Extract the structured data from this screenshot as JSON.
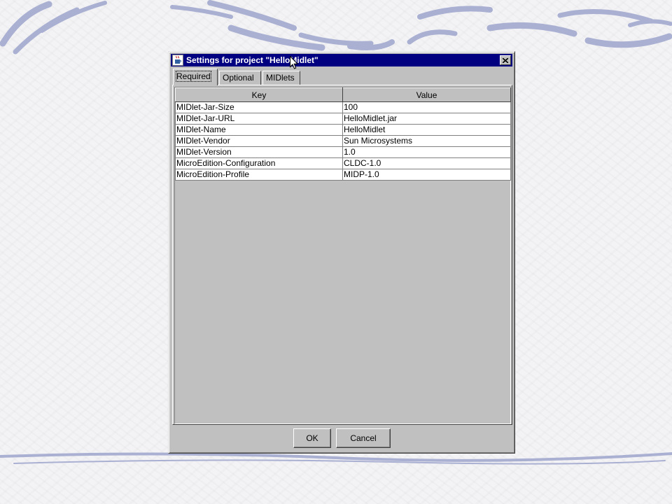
{
  "window": {
    "title": "Settings for project \"HelloMidlet\""
  },
  "tabs": [
    {
      "label": "Required",
      "active": true
    },
    {
      "label": "Optional",
      "active": false
    },
    {
      "label": "MIDlets",
      "active": false
    }
  ],
  "table": {
    "columns": [
      "Key",
      "Value"
    ],
    "rows": [
      {
        "key": "MIDlet-Jar-Size",
        "value": "100"
      },
      {
        "key": "MIDlet-Jar-URL",
        "value": "HelloMidlet.jar"
      },
      {
        "key": "MIDlet-Name",
        "value": "HelloMidlet"
      },
      {
        "key": "MIDlet-Vendor",
        "value": "Sun Microsystems"
      },
      {
        "key": "MIDlet-Version",
        "value": "1.0"
      },
      {
        "key": "MicroEdition-Configuration",
        "value": "CLDC-1.0"
      },
      {
        "key": "MicroEdition-Profile",
        "value": "MIDP-1.0"
      }
    ]
  },
  "buttons": {
    "ok": "OK",
    "cancel": "Cancel"
  },
  "icons": {
    "app": "java-cup-icon",
    "close": "close-icon",
    "cursor": "mouse-pointer-icon"
  },
  "colors": {
    "titlebar": "#000080",
    "dialog_face": "#c0c0c0",
    "decoration": "#9fa6cc"
  }
}
